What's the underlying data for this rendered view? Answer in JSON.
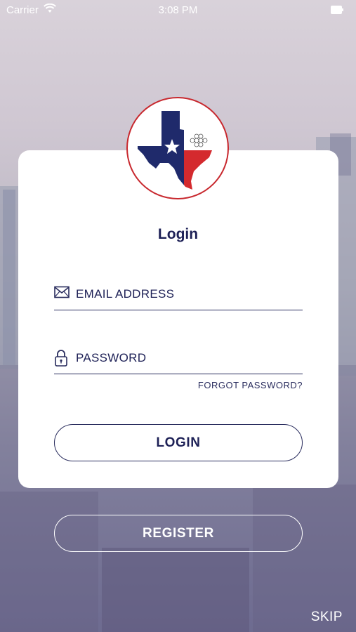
{
  "status_bar": {
    "carrier": "Carrier",
    "time": "3:08 PM"
  },
  "login_card": {
    "title": "Login",
    "email": {
      "placeholder": "EMAIL ADDRESS",
      "value": ""
    },
    "password": {
      "placeholder": "PASSWORD",
      "value": ""
    },
    "forgot_label": "FORGOT PASSWORD?",
    "login_label": "LOGIN"
  },
  "register_label": "REGISTER",
  "skip_label": "SKIP",
  "colors": {
    "navy": "#1d2056",
    "red": "#c8282e",
    "white": "#ffffff"
  },
  "icons": [
    "wifi-icon",
    "battery-icon",
    "mail-icon",
    "lock-icon",
    "texas-logo"
  ]
}
